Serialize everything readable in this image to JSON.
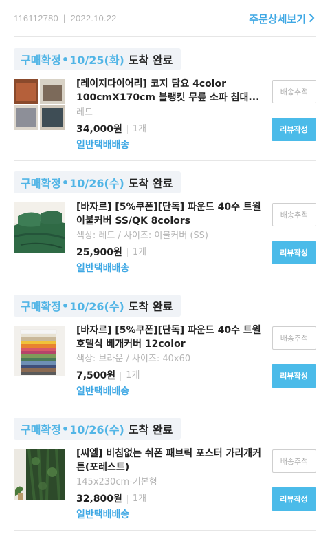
{
  "order": {
    "number": "116112780",
    "separator": "|",
    "date": "2022.10.22",
    "detail_link": "주문상세보기"
  },
  "items": [
    {
      "status_confirm": "구매확정",
      "status_dot": "•",
      "status_date": "10/25(화)",
      "status_done": "도착 완료",
      "title": "[레이지다이어리] 코지 담요 4color 100cmX170cm  블랭킷 무릎 소파 침대...",
      "option": "레드",
      "price": "34,000원",
      "qty": "1개",
      "delivery": "일반택배배송",
      "track_label": "배송추적",
      "review_label": "리뷰작성"
    },
    {
      "status_confirm": "구매확정",
      "status_dot": "•",
      "status_date": "10/26(수)",
      "status_done": "도착 완료",
      "title": "[바자르] [5%쿠폰][단독] 파운드 40수 트윌 이불커버 SS/QK 8colors",
      "option": "색상: 레드 / 사이즈: 이불커버 (SS)",
      "price": "25,900원",
      "qty": "1개",
      "delivery": "일반택배배송",
      "track_label": "배송추적",
      "review_label": "리뷰작성"
    },
    {
      "status_confirm": "구매확정",
      "status_dot": "•",
      "status_date": "10/26(수)",
      "status_done": "도착 완료",
      "title": "[바자르] [5%쿠폰][단독] 파운드 40수 트윌 호텔식 베개커버 12color",
      "option": "색상: 브라운 / 사이즈: 40x60",
      "price": "7,500원",
      "qty": "1개",
      "delivery": "일반택배배송",
      "track_label": "배송추적",
      "review_label": "리뷰작성"
    },
    {
      "status_confirm": "구매확정",
      "status_dot": "•",
      "status_date": "10/26(수)",
      "status_done": "도착 완료",
      "title": "[씨엘] 비침없는 쉬폰 패브릭 포스터 가리개커튼(포레스트)",
      "option": "145x230cm-기본형",
      "price": "32,800원",
      "qty": "1개",
      "delivery": "일반택배배송",
      "track_label": "배송추적",
      "review_label": "리뷰작성"
    }
  ],
  "colors": {
    "accent": "#3fa8e4",
    "status_blue": "#52b5e6",
    "review_button": "#4bbbe9",
    "pill_bg": "#f0f3f7"
  }
}
